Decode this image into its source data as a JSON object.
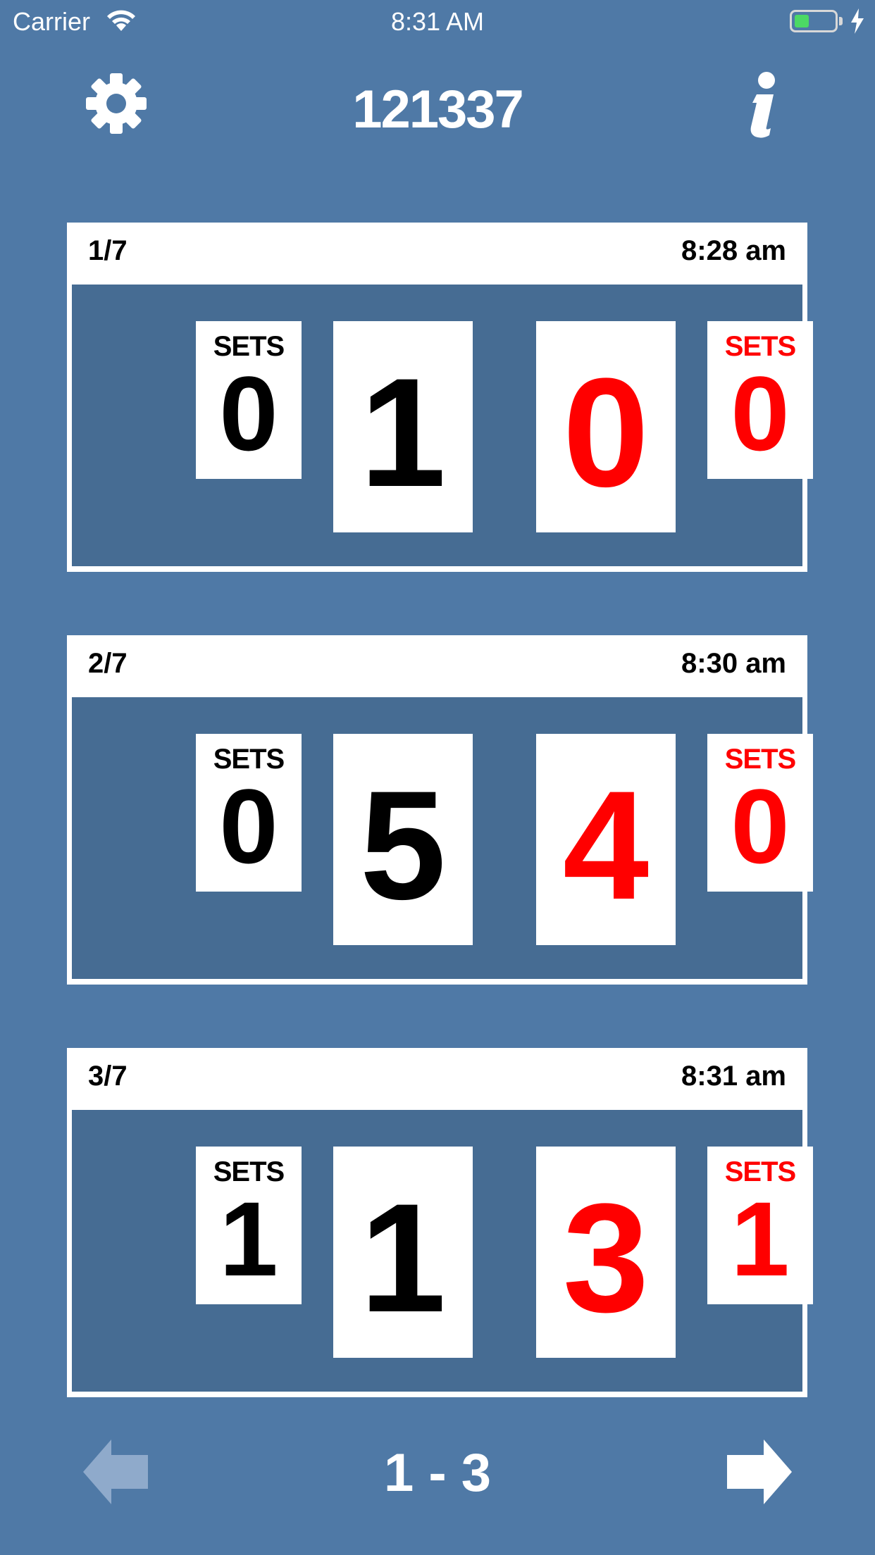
{
  "status_bar": {
    "carrier": "Carrier",
    "time": "8:31 AM",
    "battery_level": 0.35
  },
  "header": {
    "title": "121337",
    "settings_icon": "gear-icon",
    "info_icon": "info-icon"
  },
  "colors": {
    "background": "#4f79a6",
    "panel": "#466c93",
    "team_left": "#000000",
    "team_right": "#ff0000"
  },
  "matches": [
    {
      "index": "1/7",
      "time": "8:28 am",
      "left_sets_label": "SETS",
      "left_sets": "0",
      "left_score": "1",
      "right_score": "0",
      "right_sets_label": "SETS",
      "right_sets": "0"
    },
    {
      "index": "2/7",
      "time": "8:30 am",
      "left_sets_label": "SETS",
      "left_sets": "0",
      "left_score": "5",
      "right_score": "4",
      "right_sets_label": "SETS",
      "right_sets": "0"
    },
    {
      "index": "3/7",
      "time": "8:31 am",
      "left_sets_label": "SETS",
      "left_sets": "1",
      "left_score": "1",
      "right_score": "3",
      "right_sets_label": "SETS",
      "right_sets": "1"
    }
  ],
  "footer": {
    "page_range": "1 - 3",
    "prev_icon": "arrow-left-icon",
    "next_icon": "arrow-right-icon"
  }
}
